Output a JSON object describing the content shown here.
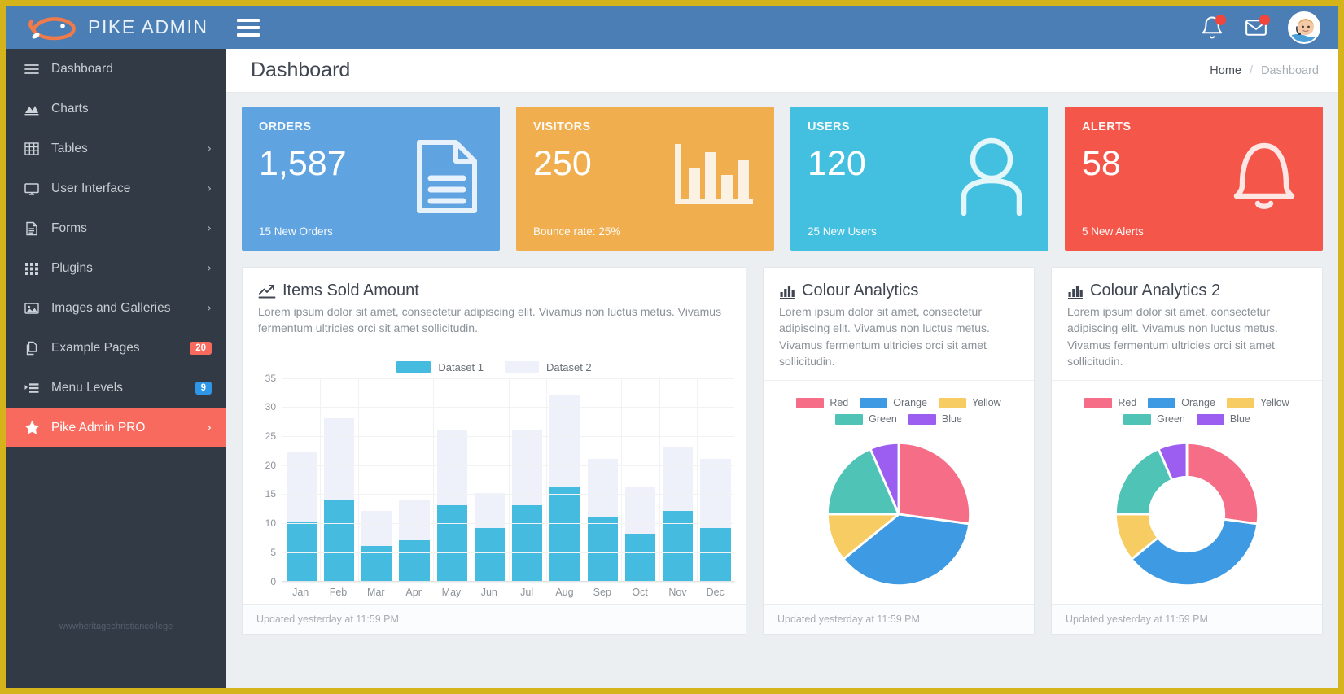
{
  "brand": {
    "name": "PIKE ADMIN",
    "logo_icon": "fish-logo-icon"
  },
  "topbar": {
    "menu_toggle_icon": "hamburger-icon",
    "notifications_icon": "bell-icon",
    "messages_icon": "envelope-icon",
    "avatar_icon": "user-avatar",
    "notifications_badge": "",
    "messages_badge": ""
  },
  "sidebar": {
    "watermark": "wwwheritagechristiancollege",
    "items": [
      {
        "label": "Dashboard",
        "icon": "menu-bars-icon",
        "caret": "",
        "badge": null,
        "active": false
      },
      {
        "label": "Charts",
        "icon": "area-chart-icon",
        "caret": "",
        "badge": null,
        "active": false
      },
      {
        "label": "Tables",
        "icon": "table-grid-icon",
        "caret": "›",
        "badge": null,
        "active": false
      },
      {
        "label": "User Interface",
        "icon": "monitor-icon",
        "caret": "›",
        "badge": null,
        "active": false
      },
      {
        "label": "Forms",
        "icon": "document-icon",
        "caret": "›",
        "badge": null,
        "active": false
      },
      {
        "label": "Plugins",
        "icon": "grid-dots-icon",
        "caret": "›",
        "badge": null,
        "active": false
      },
      {
        "label": "Images and Galleries",
        "icon": "image-icon",
        "caret": "›",
        "badge": null,
        "active": false
      },
      {
        "label": "Example Pages",
        "icon": "copy-pages-icon",
        "caret": "",
        "badge": "20",
        "badge_color": "red",
        "active": false
      },
      {
        "label": "Menu Levels",
        "icon": "list-indent-icon",
        "caret": "",
        "badge": "9",
        "badge_color": "blue",
        "active": false
      },
      {
        "label": "Pike Admin PRO",
        "icon": "star-icon",
        "caret": "›",
        "badge": null,
        "active": true
      }
    ]
  },
  "page": {
    "title": "Dashboard",
    "breadcrumb": {
      "home": "Home",
      "separator": "/",
      "current": "Dashboard"
    }
  },
  "stats": [
    {
      "label": "ORDERS",
      "value": "1,587",
      "sub": "15 New Orders",
      "color": "#5fa3e0",
      "icon": "file-document-icon"
    },
    {
      "label": "VISITORS",
      "value": "250",
      "sub": "Bounce rate: 25%",
      "color": "#f0ae4e",
      "icon": "bar-chart-icon"
    },
    {
      "label": "USERS",
      "value": "120",
      "sub": "25 New Users",
      "color": "#43bfdf",
      "icon": "user-icon"
    },
    {
      "label": "ALERTS",
      "value": "58",
      "sub": "5 New Alerts",
      "color": "#f4564a",
      "icon": "bell-icon"
    }
  ],
  "panels": {
    "items_sold": {
      "title": "Items Sold Amount",
      "icon": "line-chart-icon",
      "desc": "Lorem ipsum dolor sit amet, consectetur adipiscing elit. Vivamus non luctus metus. Vivamus fermentum ultricies orci sit amet sollicitudin.",
      "footer": "Updated yesterday at 11:59 PM"
    },
    "colour_analytics": {
      "title": "Colour Analytics",
      "icon": "bar-chart-icon",
      "desc": "Lorem ipsum dolor sit amet, consectetur adipiscing elit. Vivamus non luctus metus. Vivamus fermentum ultricies orci sit amet sollicitudin.",
      "footer": "Updated yesterday at 11:59 PM"
    },
    "colour_analytics_2": {
      "title": "Colour Analytics 2",
      "icon": "bar-chart-icon",
      "desc": "Lorem ipsum dolor sit amet, consectetur adipiscing elit. Vivamus non luctus metus. Vivamus fermentum ultricies orci sit amet sollicitudin.",
      "footer": "Updated yesterday at 11:59 PM"
    }
  },
  "chart_data": [
    {
      "id": "items-sold-bar",
      "type": "bar",
      "title": "Items Sold Amount",
      "stacked": true,
      "categories": [
        "Jan",
        "Feb",
        "Mar",
        "Apr",
        "May",
        "Jun",
        "Jul",
        "Aug",
        "Sep",
        "Oct",
        "Nov",
        "Dec"
      ],
      "series": [
        {
          "name": "Dataset 1",
          "color": "#45bcdf",
          "values": [
            10,
            14,
            6,
            7,
            13,
            9,
            13,
            16,
            11,
            8,
            12,
            9
          ]
        },
        {
          "name": "Dataset 2",
          "color": "#eef1fa",
          "values": [
            12,
            14,
            6,
            7,
            13,
            6,
            13,
            16,
            10,
            8,
            11,
            12
          ]
        }
      ],
      "totals": [
        22,
        28,
        12,
        14,
        26,
        15,
        26,
        32,
        21,
        16,
        23,
        21
      ],
      "ylabel": "",
      "xlabel": "",
      "ylim": [
        0,
        35
      ],
      "yticks": [
        0,
        5,
        10,
        15,
        20,
        25,
        30,
        35
      ],
      "grid": true,
      "legend": "top-center"
    },
    {
      "id": "colour-analytics-pie",
      "type": "pie",
      "title": "Colour Analytics",
      "labels": [
        "Red",
        "Orange",
        "Yellow",
        "Green",
        "Blue"
      ],
      "values": [
        25,
        34,
        10,
        17,
        6
      ],
      "colors": [
        "#f66d87",
        "#3d9ae3",
        "#f7cc62",
        "#4fc3b5",
        "#9b5ef0"
      ],
      "legend": "top-center"
    },
    {
      "id": "colour-analytics-doughnut",
      "type": "pie",
      "variant": "doughnut",
      "title": "Colour Analytics 2",
      "labels": [
        "Red",
        "Orange",
        "Yellow",
        "Green",
        "Blue"
      ],
      "values": [
        25,
        34,
        10,
        17,
        6
      ],
      "colors": [
        "#f66d87",
        "#3d9ae3",
        "#f7cc62",
        "#4fc3b5",
        "#9b5ef0"
      ],
      "legend": "top-center"
    }
  ],
  "pie_legend": [
    {
      "label": "Red",
      "color": "#f66d87"
    },
    {
      "label": "Orange",
      "color": "#3d9ae3"
    },
    {
      "label": "Yellow",
      "color": "#f7cc62"
    },
    {
      "label": "Green",
      "color": "#4fc3b5"
    },
    {
      "label": "Blue",
      "color": "#9b5ef0"
    }
  ]
}
